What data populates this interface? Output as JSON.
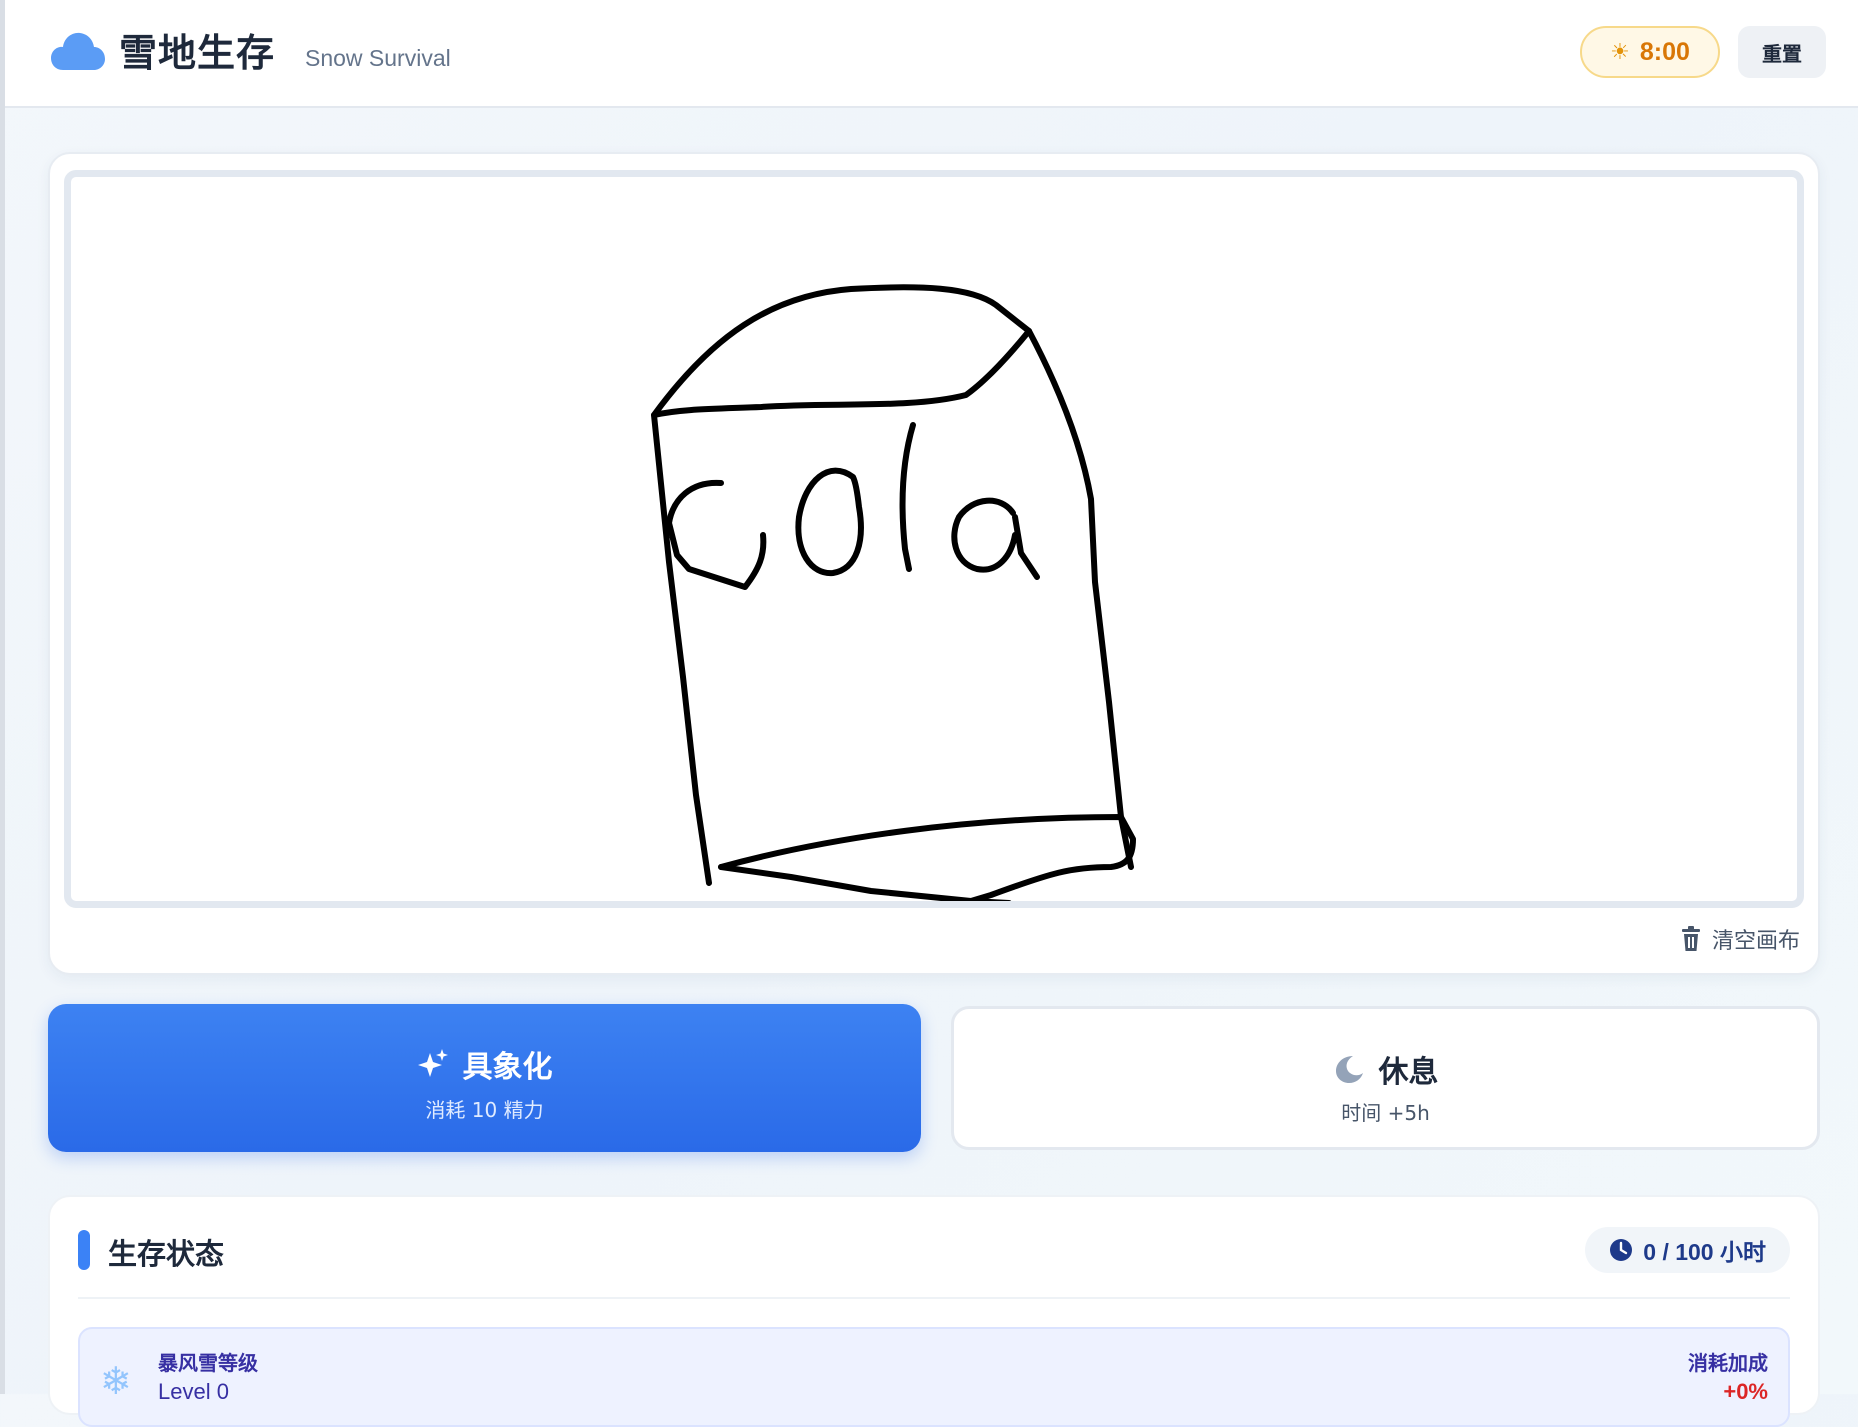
{
  "header": {
    "title": "雪地生存",
    "subtitle": "Snow Survival",
    "time": "8:00",
    "reset_label": "重置",
    "icons": {
      "logo": "cloud-icon",
      "time": "sun-icon"
    }
  },
  "canvas": {
    "clear_label": "清空画布",
    "clear_icon": "trash-icon"
  },
  "actions": {
    "materialize": {
      "label": "具象化",
      "cost": "消耗 10 精力",
      "icon": "sparkles-icon"
    },
    "rest": {
      "label": "休息",
      "effect": "时间 +5h",
      "icon": "moon-icon"
    }
  },
  "status": {
    "title": "生存状态",
    "hours": "0 / 100 小时",
    "hours_icon": "clock-icon",
    "blizzard": {
      "label": "暴风雪等级",
      "level": "Level 0",
      "bonus_label": "消耗加成",
      "bonus_value": "+0%",
      "icon": "snowflake-icon"
    }
  },
  "colors": {
    "accent": "#3b82f6",
    "time_text": "#d97706",
    "bonus": "#dc2626"
  }
}
